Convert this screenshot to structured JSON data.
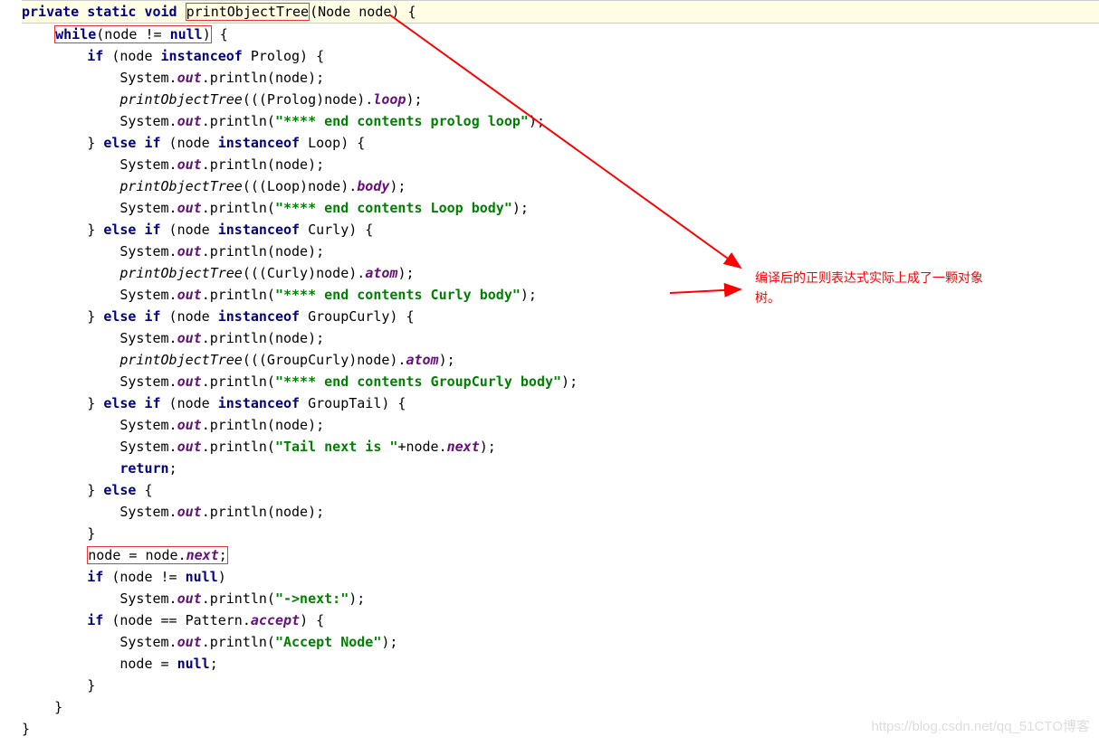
{
  "annotation": {
    "line1": "编译后的正则表达式实际上成了一颗对象",
    "line2": "树。"
  },
  "watermark": "https://blog.csdn.net/qq_51CTO博客",
  "code": {
    "l0": "private static void printObjectTree(Node node) {",
    "l1_a": "    ",
    "l1_b": "while(node != null)",
    "l1_c": " {",
    "l2": "        if (node instanceof Prolog) {",
    "l3": "            System.out.println(node);",
    "l4": "            printObjectTree(((Prolog)node).loop);",
    "l5": "            System.out.println(\"**** end contents prolog loop\");",
    "l6": "        } else if (node instanceof Loop) {",
    "l7": "            System.out.println(node);",
    "l8": "            printObjectTree(((Loop)node).body);",
    "l9": "            System.out.println(\"**** end contents Loop body\");",
    "l10": "        } else if (node instanceof Curly) {",
    "l11": "            System.out.println(node);",
    "l12": "            printObjectTree(((Curly)node).atom);",
    "l13": "            System.out.println(\"**** end contents Curly body\");",
    "l14": "        } else if (node instanceof GroupCurly) {",
    "l15": "            System.out.println(node);",
    "l16": "            printObjectTree(((GroupCurly)node).atom);",
    "l17": "            System.out.println(\"**** end contents GroupCurly body\");",
    "l18": "        } else if (node instanceof GroupTail) {",
    "l19": "            System.out.println(node);",
    "l20": "            System.out.println(\"Tail next is \"+node.next);",
    "l21": "            return;",
    "l22": "        } else {",
    "l23": "            System.out.println(node);",
    "l24": "        }",
    "l25_a": "        ",
    "l25_b": "node = node.next;",
    "l26": "        if (node != null)",
    "l27": "            System.out.println(\"->next:\");",
    "l28": "        if (node == Pattern.accept) {",
    "l29": "            System.out.println(\"Accept Node\");",
    "l30": "            node = null;",
    "l31": "        }",
    "l32": "    }",
    "l33": "}"
  }
}
